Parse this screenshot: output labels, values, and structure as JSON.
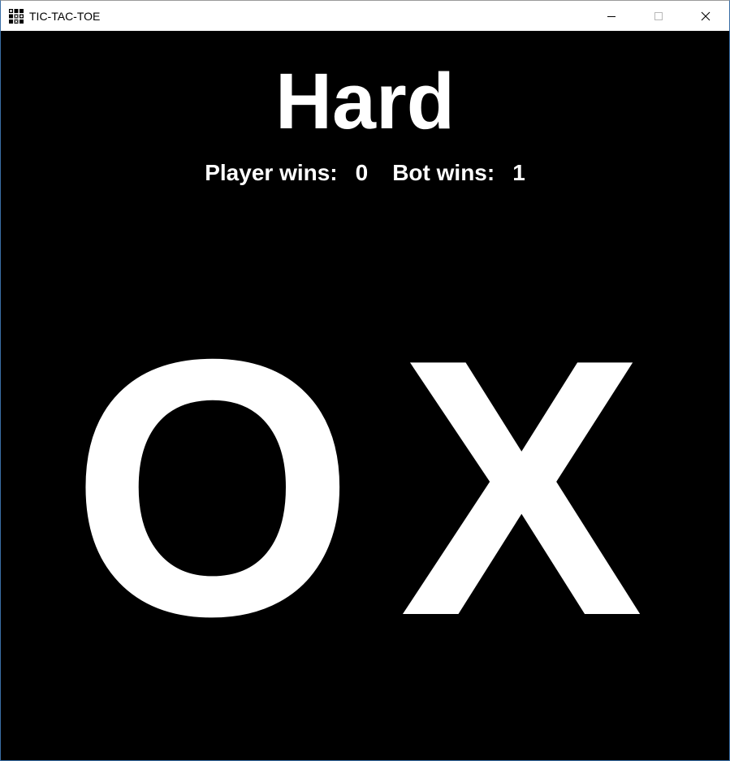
{
  "window": {
    "title": "TIC-TAC-TOE",
    "app_icon": "tic-tac-toe-grid-icon",
    "controls": {
      "minimize_icon": "minimize-icon",
      "maximize_icon": "maximize-icon",
      "close_icon": "close-icon"
    }
  },
  "game": {
    "difficulty": "Hard",
    "player_wins_label": "Player wins:",
    "player_wins": "0",
    "bot_wins_label": "Bot wins:",
    "bot_wins": "1",
    "left_letter": "O",
    "right_letter": "X"
  },
  "colors": {
    "background": "#000000",
    "text": "#ffffff",
    "titlebar": "#ffffff"
  }
}
